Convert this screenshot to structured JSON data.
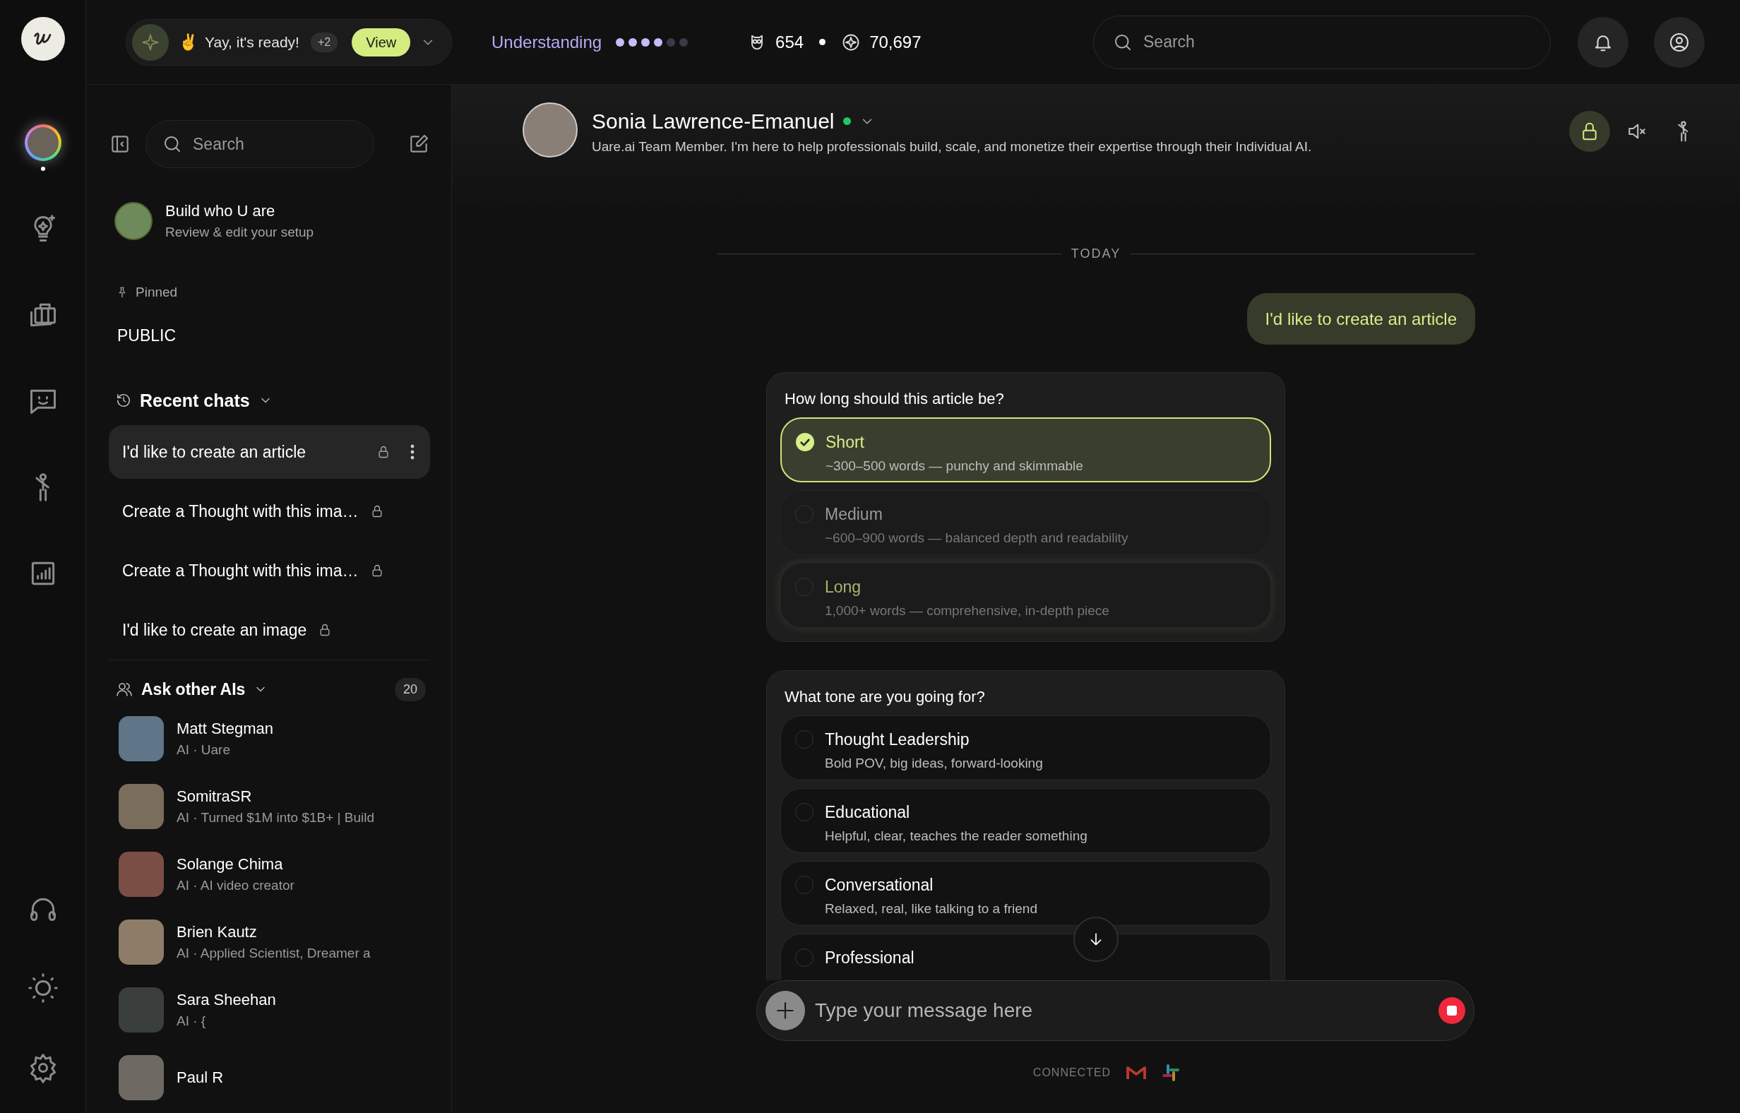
{
  "top_bar": {
    "notification": {
      "emoji": "✌️",
      "text": "Yay, it's ready!",
      "count": "+2",
      "action": "View"
    },
    "progress": {
      "label": "Understanding",
      "stars": 4
    },
    "stats": [
      {
        "value": "654"
      },
      {
        "value": "70,697"
      }
    ],
    "search": {
      "placeholder": "Search"
    }
  },
  "rail": {
    "items": [
      {
        "selected": true
      },
      {
        "selected": false
      },
      {
        "selected": false
      },
      {
        "selected": false
      },
      {
        "selected": false
      },
      {
        "selected": false
      }
    ]
  },
  "sidebar": {
    "search": {
      "placeholder": "Search"
    },
    "setup": {
      "title": "Build who U are",
      "subtitle": "Review & edit your setup"
    },
    "pinned": {
      "label": "Pinned",
      "items": [
        {
          "label": "PUBLIC"
        }
      ]
    },
    "recent": {
      "title": "Recent chats",
      "items": [
        {
          "label": "I'd like to create an article",
          "selected": true
        },
        {
          "label": "Create a Thought with this ima…",
          "selected": false
        },
        {
          "label": "Create a Thought with this ima…",
          "selected": false
        },
        {
          "label": "I'd like to create an image",
          "selected": false
        }
      ]
    },
    "ask_other": {
      "title": "Ask other AIs",
      "count": "20",
      "people": [
        {
          "name": "Matt Stegman",
          "subtitle": "AI · Uare"
        },
        {
          "name": "SomitraSR",
          "subtitle": "AI · Turned $1M into $1B+ | Build"
        },
        {
          "name": "Solange Chima",
          "subtitle": "AI · AI video creator"
        },
        {
          "name": "Brien Kautz",
          "subtitle": "AI · Applied Scientist, Dreamer a"
        },
        {
          "name": "Sara Sheehan",
          "subtitle": "AI · {"
        },
        {
          "name": "Paul R"
        }
      ]
    }
  },
  "chat": {
    "header": {
      "name": "Sonia Lawrence-Emanuel",
      "online": true,
      "description": "Uare.ai Team Member. I'm here to help professionals build, scale, and monetize their expertise through their Individual AI."
    },
    "date_divider": "TODAY",
    "messages": [
      {
        "kind": "user",
        "text": "I'd like to create an article"
      },
      {
        "kind": "question",
        "question": "How long should this article be?",
        "answered": true,
        "options": [
          {
            "label": "Short",
            "description": "~300–500 words — punchy and skimmable",
            "selected": true,
            "hovered": false
          },
          {
            "label": "Medium",
            "description": "~600–900 words — balanced depth and readability",
            "selected": false,
            "hovered": false
          },
          {
            "label": "Long",
            "description": "1,000+ words — comprehensive, in-depth piece",
            "selected": false,
            "hovered": true
          }
        ]
      },
      {
        "kind": "question",
        "question": "What tone are you going for?",
        "answered": false,
        "options": [
          {
            "label": "Thought Leadership",
            "description": "Bold POV, big ideas, forward-looking",
            "selected": false,
            "hovered": false
          },
          {
            "label": "Educational",
            "description": "Helpful, clear, teaches the reader something",
            "selected": false,
            "hovered": false
          },
          {
            "label": "Conversational",
            "description": "Relaxed, real, like talking to a friend",
            "selected": false,
            "hovered": false
          },
          {
            "label": "Professional",
            "selected": false,
            "hovered": false
          }
        ]
      }
    ],
    "composer": {
      "placeholder": "Type your message here"
    },
    "connected": {
      "label": "CONNECTED"
    }
  }
}
